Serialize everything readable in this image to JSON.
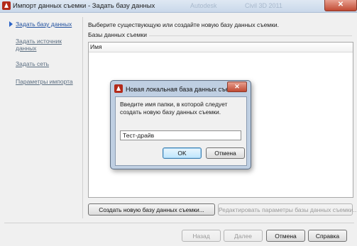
{
  "window": {
    "title": "Импорт данных съемки - Задать базу данных",
    "ghost_text_1": "Autodesk",
    "ghost_text_2": "Civil 3D 2011",
    "close_glyph": "✕"
  },
  "nav": {
    "items": [
      {
        "label": "Задать базу данных",
        "active": true
      },
      {
        "label": "Задать источник данных",
        "active": false
      },
      {
        "label": "Задать сеть",
        "active": false
      },
      {
        "label": "Параметры импорта",
        "active": false
      }
    ]
  },
  "main": {
    "intro": "Выберите существующую или создайте новую базу данных съемки.",
    "group_label": "Базы данных съемки",
    "list_column": "Имя",
    "create_button": "Создать новую базу данных съемки...",
    "edit_button": "Редактировать параметры базы данных съемки..."
  },
  "footer": {
    "back": "Назад",
    "next": "Далее",
    "cancel": "Отмена",
    "help": "Справка"
  },
  "dialog": {
    "title": "Новая локальная база данных съе...",
    "message": "Введите имя папки, в которой следует создать новую базу данных съемки.",
    "input_value": "Тест-драйв",
    "ok": "OK",
    "cancel": "Отмена",
    "close_glyph": "✕"
  },
  "icons": {
    "app": "civil3d-app-icon",
    "dialog": "civil3d-app-icon",
    "nav_active": "current-step-arrow-icon"
  },
  "colors": {
    "nav_active": "#1f4f9e",
    "nav_inactive": "#5a6d80",
    "close_button": "#c04a33",
    "dialog_frame": "#bfcfe2"
  }
}
